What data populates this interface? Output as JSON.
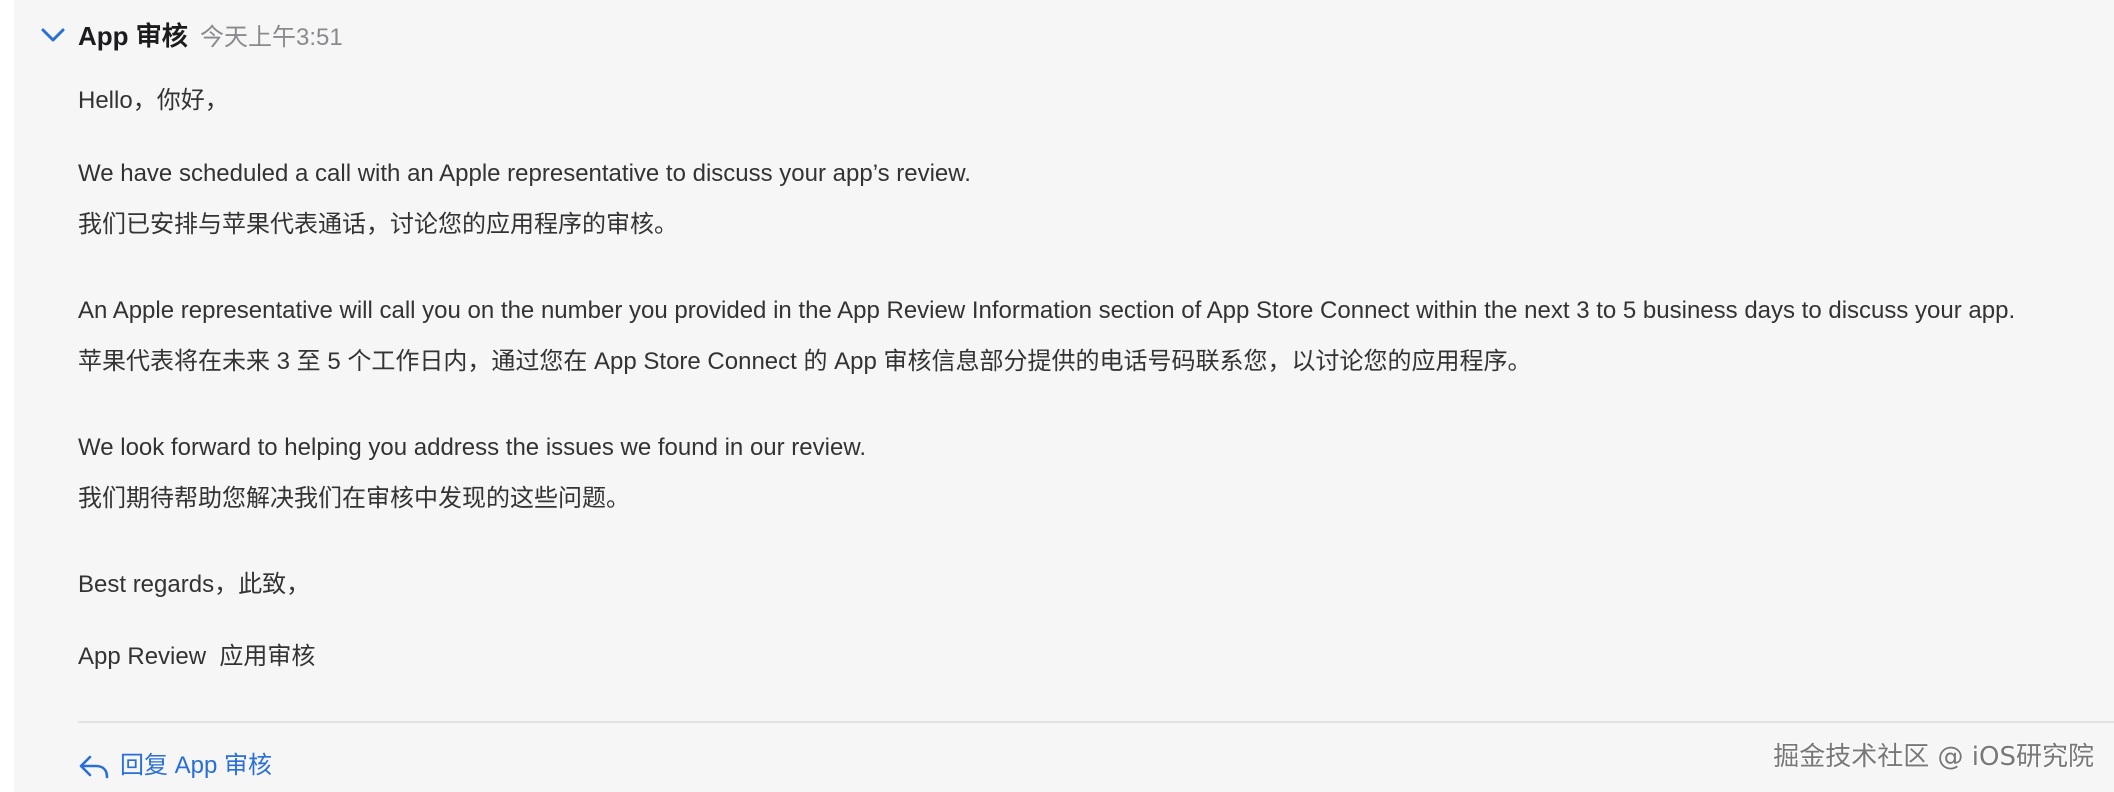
{
  "header": {
    "collapse_icon": "chevron-down-icon",
    "sender": "App 审核",
    "time": "今天上午3:51"
  },
  "message": {
    "greeting": "Hello，你好，",
    "p1_en": "We have scheduled a call with an Apple representative to discuss your app’s review.",
    "p1_zh": "我们已安排与苹果代表通话，讨论您的应用程序的审核。",
    "p2_en": "An Apple representative will call you on the number you provided in the App Review Information section of App Store Connect within the next 3 to 5 business days to discuss your app.",
    "p2_zh": "苹果代表将在未来 3 至 5 个工作日内，通过您在 App Store Connect 的 App 审核信息部分提供的电话号码联系您，以讨论您的应用程序。",
    "p3_en": "We look forward to helping you address the issues we found in our review.",
    "p3_zh": "我们期待帮助您解决我们在审核中发现的这些问题。",
    "closing": "Best regards，此致，",
    "signature": "App Review  应用审核"
  },
  "footer": {
    "reply_icon": "reply-icon",
    "reply_label": "回复 App 审核"
  },
  "watermark": {
    "text": "掘金技术社区 @ iOS研究院"
  },
  "colors": {
    "accent": "#2a6fd6",
    "panel_background": "#f6f6f7",
    "body_text": "#333333",
    "muted_text": "#8a8a8e"
  }
}
